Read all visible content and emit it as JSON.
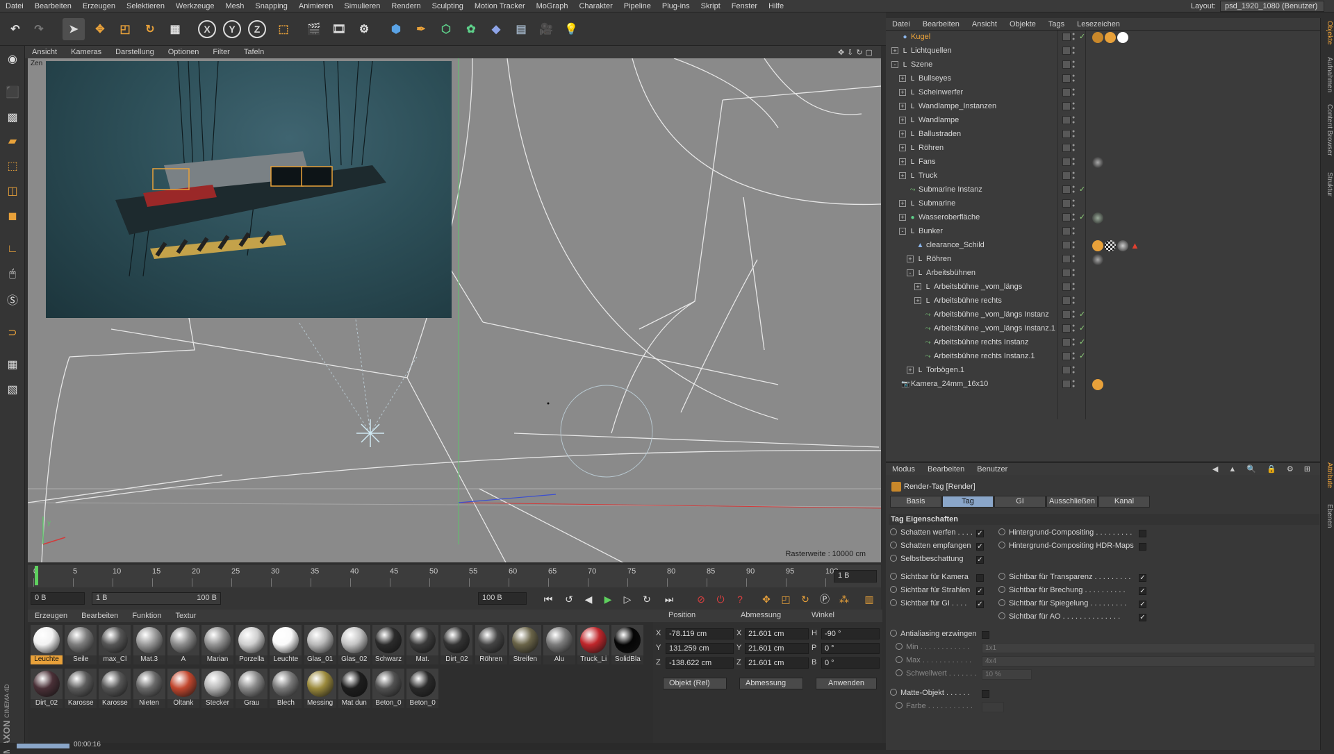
{
  "menubar": {
    "items": [
      "Datei",
      "Bearbeiten",
      "Erzeugen",
      "Selektieren",
      "Werkzeuge",
      "Mesh",
      "Snapping",
      "Animieren",
      "Simulieren",
      "Rendern",
      "Sculpting",
      "Motion Tracker",
      "MoGraph",
      "Charakter",
      "Pipeline",
      "Plug-ins",
      "Skript",
      "Fenster",
      "Hilfe"
    ],
    "layout_label": "Layout:",
    "layout_value": "psd_1920_1080 (Benutzer)"
  },
  "toolbar": {
    "x_label": "X",
    "y_label": "Y",
    "z_label": "Z"
  },
  "viewport": {
    "menu": [
      "Ansicht",
      "Kameras",
      "Darstellung",
      "Optionen",
      "Filter",
      "Tafeln"
    ],
    "camera_label": "Zen",
    "raster": "Rasterweite : 10000 cm",
    "axis_y": "y"
  },
  "timeline": {
    "ticks": [
      "0",
      "5",
      "10",
      "15",
      "20",
      "25",
      "30",
      "35",
      "40",
      "45",
      "50",
      "55",
      "60",
      "65",
      "70",
      "75",
      "80",
      "85",
      "90",
      "95",
      "100"
    ],
    "frame_field": "1 B",
    "start_field": "0 B",
    "range_start": "1 B",
    "range_end": "100 B",
    "end_field": "100 B"
  },
  "materials": {
    "menu": [
      "Erzeugen",
      "Bearbeiten",
      "Funktion",
      "Textur"
    ],
    "row1": [
      {
        "name": "Leuchte",
        "color": "#f2f2f2",
        "selected": true
      },
      {
        "name": "Seile",
        "color": "#7c7c7c"
      },
      {
        "name": "max_Cl",
        "color": "#555"
      },
      {
        "name": "Mat.3",
        "color": "#9a9a9a"
      },
      {
        "name": "A",
        "color": "#8c8c8c"
      },
      {
        "name": "Marian",
        "color": "#939393"
      },
      {
        "name": "Porzella",
        "color": "#cfcfcf"
      },
      {
        "name": "Leuchte",
        "color": "#fafafa"
      },
      {
        "name": "Glas_01",
        "color": "#b9b9b9"
      },
      {
        "name": "Glas_02",
        "color": "#c4c4c4"
      },
      {
        "name": "Schwarz",
        "color": "#2b2b2b"
      },
      {
        "name": "Mat.",
        "color": "#3b3b3b"
      },
      {
        "name": "Dirt_02",
        "color": "#333"
      },
      {
        "name": "Röhren",
        "color": "#444"
      },
      {
        "name": "Streifen",
        "color": "#6a6448"
      },
      {
        "name": "Alu",
        "color": "#7b7b7b"
      },
      {
        "name": "Truck_Li",
        "color": "#c0262b"
      },
      {
        "name": "SolidBla",
        "color": "#050505"
      }
    ],
    "row2": [
      {
        "name": "Dirt_02",
        "color": "#4a3037"
      },
      {
        "name": "Karosse",
        "color": "#5d5d5d"
      },
      {
        "name": "Karosse",
        "color": "#575757"
      },
      {
        "name": "Nieten",
        "color": "#6a6a6a"
      },
      {
        "name": "Öltank",
        "color": "#c2472e"
      },
      {
        "name": "Stecker",
        "color": "#b5b5b5"
      },
      {
        "name": "Grau",
        "color": "#8a8a8a"
      },
      {
        "name": "Blech",
        "color": "#7a7a7a"
      },
      {
        "name": "Messing",
        "color": "#9b8a3c"
      },
      {
        "name": "Mat dun",
        "color": "#1d1d1d"
      },
      {
        "name": "Beton_0",
        "color": "#525252"
      },
      {
        "name": "Beton_0",
        "color": "#2a2a2a"
      }
    ]
  },
  "coords": {
    "headers": [
      "Position",
      "Abmessung",
      "Winkel"
    ],
    "rows": [
      {
        "axis": "X",
        "pos": "-78.119 cm",
        "dim_axis": "X",
        "dim": "21.601 cm",
        "ang_axis": "H",
        "ang": "-90 °"
      },
      {
        "axis": "Y",
        "pos": "131.259 cm",
        "dim_axis": "Y",
        "dim": "21.601 cm",
        "ang_axis": "P",
        "ang": "0 °"
      },
      {
        "axis": "Z",
        "pos": "-138.622 cm",
        "dim_axis": "Z",
        "dim": "21.601 cm",
        "ang_axis": "B",
        "ang": "0 °"
      }
    ],
    "mode_select": "Objekt (Rel)",
    "dim_select": "Abmessung",
    "apply_label": "Anwenden"
  },
  "status": {
    "time": "00:00:16"
  },
  "object_manager": {
    "menu": [
      "Datei",
      "Bearbeiten",
      "Ansicht",
      "Objekte",
      "Tags",
      "Lesezeichen"
    ],
    "objects": [
      {
        "name": "Kugel",
        "indent": 0,
        "expander": "",
        "icon": "sphere",
        "active": true,
        "check": true
      },
      {
        "name": "Lichtquellen",
        "indent": 0,
        "expander": "+",
        "icon": "null",
        "check": false
      },
      {
        "name": "Szene",
        "indent": 0,
        "expander": "-",
        "icon": "null",
        "check": false
      },
      {
        "name": "Bullseyes",
        "indent": 1,
        "expander": "+",
        "icon": "null",
        "check": false
      },
      {
        "name": "Scheinwerfer",
        "indent": 1,
        "expander": "+",
        "icon": "null",
        "check": false
      },
      {
        "name": "Wandlampe_Instanzen",
        "indent": 1,
        "expander": "+",
        "icon": "null",
        "check": false
      },
      {
        "name": "Wandlampe",
        "indent": 1,
        "expander": "+",
        "icon": "null",
        "check": false
      },
      {
        "name": "Ballustraden",
        "indent": 1,
        "expander": "+",
        "icon": "null",
        "check": false
      },
      {
        "name": "Röhren",
        "indent": 1,
        "expander": "+",
        "icon": "null",
        "check": false
      },
      {
        "name": "Fans",
        "indent": 1,
        "expander": "+",
        "icon": "null",
        "check": false
      },
      {
        "name": "Truck",
        "indent": 1,
        "expander": "+",
        "icon": "null",
        "check": false
      },
      {
        "name": "Submarine Instanz",
        "indent": 1,
        "expander": "",
        "icon": "instance",
        "check": true
      },
      {
        "name": "Submarine",
        "indent": 1,
        "expander": "+",
        "icon": "null",
        "check": false
      },
      {
        "name": "Wasseroberfläche",
        "indent": 1,
        "expander": "+",
        "icon": "water",
        "check": true
      },
      {
        "name": "Bunker",
        "indent": 1,
        "expander": "-",
        "icon": "null",
        "check": false
      },
      {
        "name": "clearance_Schild",
        "indent": 2,
        "expander": "",
        "icon": "poly",
        "check": false
      },
      {
        "name": "Röhren",
        "indent": 2,
        "expander": "+",
        "icon": "null",
        "check": false
      },
      {
        "name": "Arbeitsbühnen",
        "indent": 2,
        "expander": "-",
        "icon": "null",
        "check": false
      },
      {
        "name": "Arbeitsbühne _vom_längs",
        "indent": 3,
        "expander": "+",
        "icon": "null",
        "check": false
      },
      {
        "name": "Arbeitsbühne rechts",
        "indent": 3,
        "expander": "+",
        "icon": "null",
        "check": false
      },
      {
        "name": "Arbeitsbühne _vom_längs Instanz",
        "indent": 3,
        "expander": "",
        "icon": "instance",
        "check": true
      },
      {
        "name": "Arbeitsbühne _vom_längs Instanz.1",
        "indent": 3,
        "expander": "",
        "icon": "instance",
        "check": true
      },
      {
        "name": "Arbeitsbühne rechts Instanz",
        "indent": 3,
        "expander": "",
        "icon": "instance",
        "check": true
      },
      {
        "name": "Arbeitsbühne rechts Instanz.1",
        "indent": 3,
        "expander": "",
        "icon": "instance",
        "check": true
      },
      {
        "name": "Torbögen.1",
        "indent": 2,
        "expander": "+",
        "icon": "null",
        "check": false
      },
      {
        "name": "Kamera_24mm_16x10",
        "indent": 0,
        "expander": "",
        "icon": "camera",
        "check": false
      }
    ]
  },
  "attribute_manager": {
    "menu": [
      "Modus",
      "Bearbeiten",
      "Benutzer"
    ],
    "title": "Render-Tag [Render]",
    "tabs": [
      "Basis",
      "Tag",
      "GI",
      "Ausschließen",
      "Kanal"
    ],
    "active_tab": "Tag",
    "section": "Tag Eigenschaften",
    "left_props": [
      {
        "label": "Schatten werfen . . . .",
        "checked": true
      },
      {
        "label": "Schatten empfangen",
        "checked": true
      },
      {
        "label": "Selbstbeschattung",
        "checked": true
      },
      {
        "label": "Sichtbar für Kamera",
        "checked": false
      },
      {
        "label": "Sichtbar für Strahlen",
        "checked": true
      },
      {
        "label": "Sichtbar für GI . . . .",
        "checked": true
      }
    ],
    "right_props": [
      {
        "label": "Hintergrund-Compositing . . . . . . . . .",
        "checked": false
      },
      {
        "label": "Hintergrund-Compositing HDR-Maps",
        "checked": false
      },
      {
        "label": "Sichtbar für Transparenz . . . . . . . . .",
        "checked": true
      },
      {
        "label": "Sichtbar für Brechung . . . . . . . . . .",
        "checked": true
      },
      {
        "label": "Sichtbar für Spiegelung . . . . . . . . .",
        "checked": true
      },
      {
        "label": "Sichtbar für AO . . . . . . . . . . . . . .",
        "checked": true
      }
    ],
    "antialias": {
      "label": "Antialiasing erzwingen",
      "checked": false
    },
    "min_label": "Min . . . . . . . . . . . .",
    "min_value": "1x1",
    "max_label": "Max . . . . . . . . . . . .",
    "max_value": "4x4",
    "threshold_label": "Schwellwert . . . . . . .",
    "threshold_value": "10 %",
    "matte": {
      "label": "Matte-Objekt . . . . . .",
      "checked": false
    },
    "color_label": "Farbe . . . . . . . . . . ."
  },
  "side_tabs": [
    "Objekte",
    "Aufnahmen",
    "Content Browser",
    "Struktur",
    "Attribute",
    "Ebenen"
  ],
  "logo": {
    "brand": "MAXON",
    "product": "CINEMA 4D"
  }
}
